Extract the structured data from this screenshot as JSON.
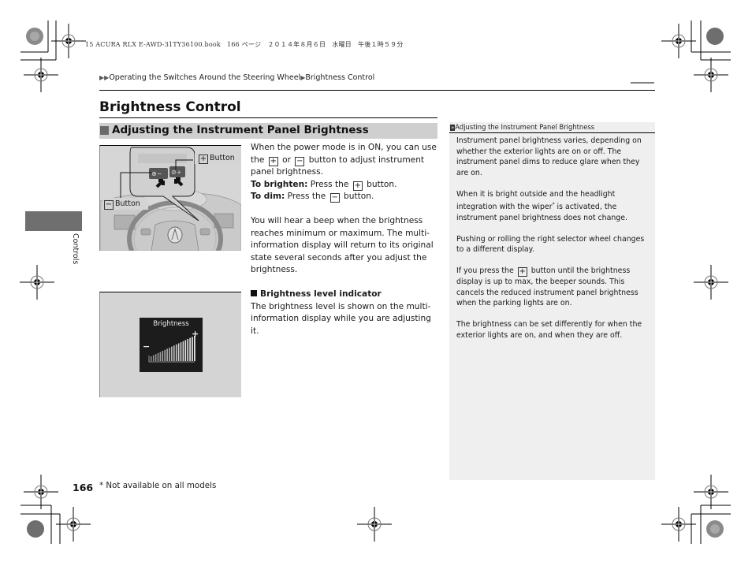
{
  "print_header": "15 ACURA RLX E-AWD-31TY36100.book　166 ページ　２０１４年８月６日　水曜日　午後１時５９分",
  "breadcrumb": {
    "arrow": "▶▶",
    "parent": "Operating the Switches Around the Steering Wheel",
    "separator": "▶",
    "current": "Brightness Control"
  },
  "page_title": "Brightness Control",
  "section": {
    "title": "Adjusting the Instrument Panel Brightness"
  },
  "figure1": {
    "plus_label": "Button",
    "minus_label": "Button",
    "plus_symbol": "+",
    "minus_symbol": "−"
  },
  "figure2": {
    "display_title": "Brightness",
    "minus_symbol": "−",
    "plus_symbol": "+"
  },
  "main_text": {
    "intro_1": "When the power mode is in ON, you can use the",
    "intro_or": "or",
    "intro_2": "button to adjust instrument panel brightness.",
    "brighten_label": "To brighten:",
    "brighten_text_1": "Press the",
    "brighten_text_2": "button.",
    "dim_label": "To dim:",
    "dim_text_1": "Press the",
    "dim_text_2": "button.",
    "beep_paragraph": "You will hear a beep when the brightness reaches minimum or maximum. The multi-information display will return to its original state several seconds after you adjust the brightness.",
    "indicator_heading": "Brightness level indicator",
    "indicator_text": "The brightness level is shown on the multi-information display while you are adjusting it.",
    "plus_symbol": "+",
    "minus_symbol": "−"
  },
  "side_tab": {
    "label": "Controls"
  },
  "sidebar": {
    "heading_icon": "»",
    "heading": "Adjusting the Instrument Panel Brightness",
    "p1": "Instrument panel brightness varies, depending on whether the exterior lights are on or off. The instrument panel dims to reduce glare when they are on.",
    "p2_a": "When it is bright outside and the headlight integration with the wiper",
    "p2_star": "*",
    "p2_b": " is activated, the instrument panel brightness does not change.",
    "p3": "Pushing or rolling the right selector wheel changes to a different display.",
    "p4_a": "If you press the",
    "p4_b": "button until the brightness display is up to max, the beeper sounds. This cancels the reduced instrument panel brightness when the parking lights are on.",
    "p5": "The brightness can be set differently for when the exterior lights are on, and when they are off.",
    "plus_symbol": "+"
  },
  "footer": {
    "page_number": "166",
    "footnote": "* Not available on all models"
  }
}
